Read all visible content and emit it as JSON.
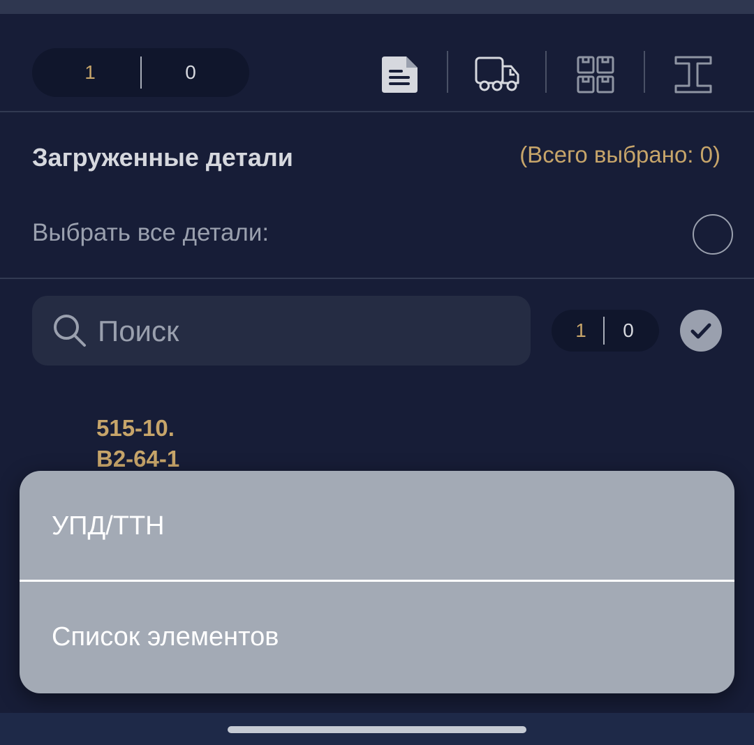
{
  "toolbar": {
    "counter_left": "1",
    "counter_right": "0",
    "icons": [
      "document-icon",
      "truck-icon",
      "grid-boxes-icon",
      "i-beam-icon"
    ]
  },
  "section": {
    "title": "Загруженные детали",
    "total_selected": "(Всего выбрано: 0)"
  },
  "select_all": {
    "label": "Выбрать все детали:"
  },
  "search": {
    "placeholder": "Поиск",
    "value": "",
    "counter_left": "1",
    "counter_right": "0"
  },
  "part": {
    "code_line1": "515-10.",
    "code_line2": "B2-64-1"
  },
  "action_sheet": {
    "items": [
      {
        "label": "УПД/ТТН"
      },
      {
        "label": "Список элементов"
      }
    ]
  },
  "colors": {
    "background": "#171d37",
    "accent_gold": "#c7a56a",
    "sheet": "#a3aab5"
  }
}
